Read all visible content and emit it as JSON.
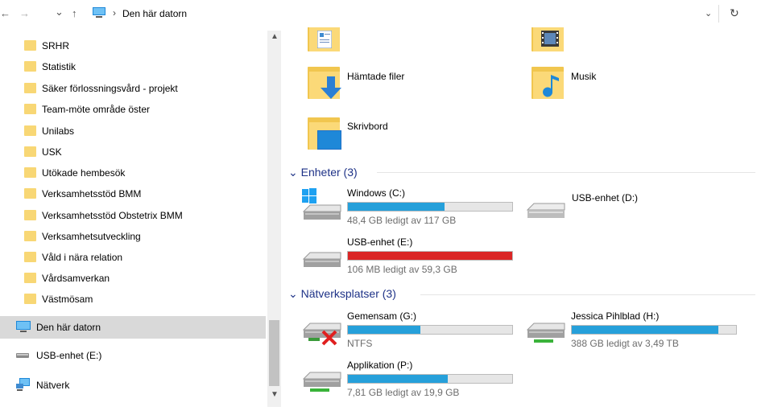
{
  "address_bar": {
    "back_glyph": "←",
    "forward_glyph": "→",
    "recent_glyph": "⌄",
    "up_glyph": "↑",
    "breadcrumb_sep": "›",
    "breadcrumb": "Den här datorn",
    "dropdown_glyph": "⌄",
    "refresh_glyph": "↻"
  },
  "nav": {
    "folders": [
      {
        "label": "SRHR"
      },
      {
        "label": "Statistik"
      },
      {
        "label": "Säker förlossningsvård - projekt"
      },
      {
        "label": "Team-möte område öster"
      },
      {
        "label": "Unilabs"
      },
      {
        "label": "USK"
      },
      {
        "label": "Utökade hembesök"
      },
      {
        "label": "Verksamhetsstöd BMM"
      },
      {
        "label": "Verksamhetsstöd Obstetrix BMM"
      },
      {
        "label": "Verksamhetsutveckling"
      },
      {
        "label": "Våld i nära relation"
      },
      {
        "label": "Vårdsamverkan"
      },
      {
        "label": "Västmösam"
      }
    ],
    "this_pc": "Den här datorn",
    "usb": "USB-enhet (E:)",
    "network": "Nätverk"
  },
  "scrollbar": {
    "up": "▲",
    "down": "▼"
  },
  "folders": {
    "downloads": "Hämtade filer",
    "music": "Musik",
    "desktop": "Skrivbord"
  },
  "groups": {
    "devices": {
      "chevron": "⌄",
      "title": "Enheter (3)"
    },
    "network": {
      "chevron": "⌄",
      "title": "Nätverksplatser (3)"
    }
  },
  "drives": {
    "c": {
      "name": "Windows (C:)",
      "info": "48,4 GB ledigt av 117 GB",
      "used_fraction": 0.59
    },
    "d": {
      "name": "USB-enhet (D:)"
    },
    "e": {
      "name": "USB-enhet (E:)",
      "info": "106 MB ledigt av 59,3 GB",
      "used_fraction": 0.998
    },
    "g": {
      "name": "Gemensam (G:)",
      "info": "NTFS",
      "used_fraction": 0.44
    },
    "h": {
      "name": "Jessica Pihlblad (H:)",
      "info": "388 GB ledigt av 3,49 TB",
      "used_fraction": 0.89
    },
    "p": {
      "name": "Applikation (P:)",
      "info": "7,81 GB ledigt av 19,9 GB",
      "used_fraction": 0.61
    }
  },
  "colors": {
    "bar_fill": "#26a0da",
    "bar_full": "#da2626",
    "group_header": "#1e3287",
    "selection": "#d9d9d9"
  }
}
